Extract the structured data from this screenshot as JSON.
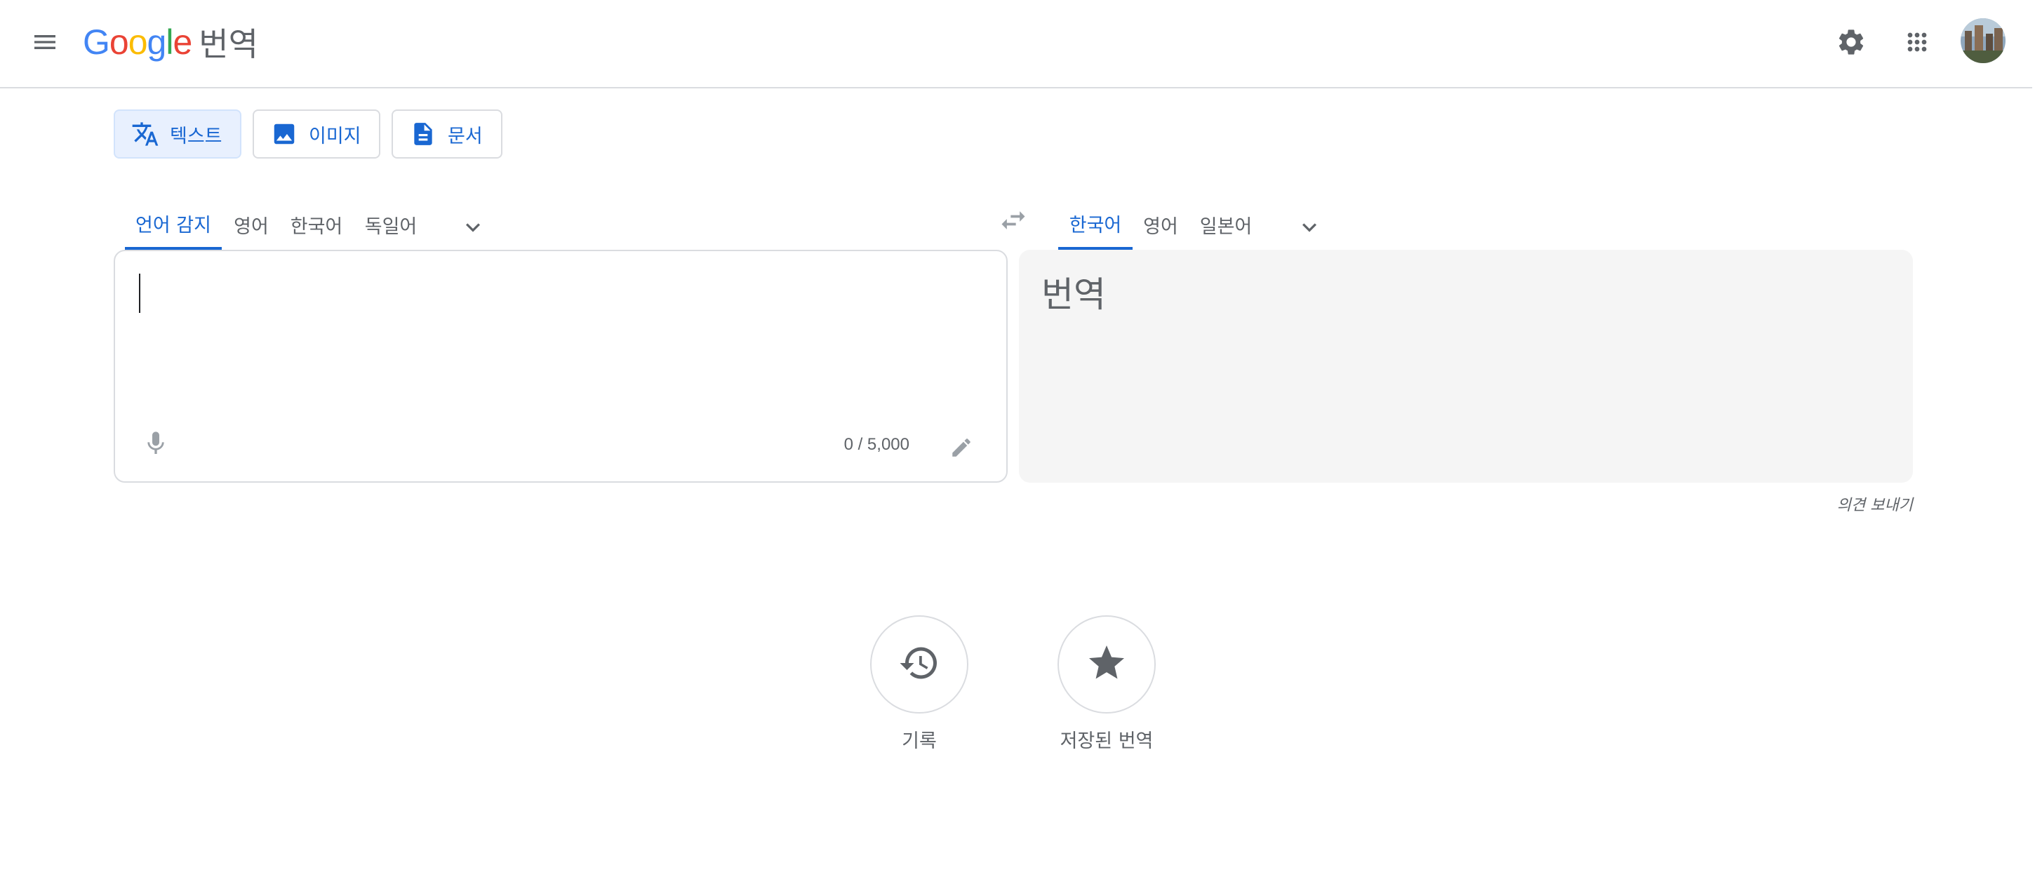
{
  "header": {
    "logo_word": "Google",
    "product_name": "번역",
    "icons": {
      "menu": "menu-icon",
      "settings": "gear-icon",
      "apps": "apps-grid-icon",
      "account": "account-avatar"
    }
  },
  "modes": [
    {
      "label": "텍스트",
      "icon": "translate-icon",
      "active": true
    },
    {
      "label": "이미지",
      "icon": "image-icon",
      "active": false
    },
    {
      "label": "문서",
      "icon": "document-icon",
      "active": false
    }
  ],
  "source": {
    "tabs": [
      {
        "label": "언어 감지",
        "active": true
      },
      {
        "label": "영어",
        "active": false
      },
      {
        "label": "한국어",
        "active": false
      },
      {
        "label": "독일어",
        "active": false
      }
    ],
    "input_value": "",
    "char_count": "0 / 5,000"
  },
  "target": {
    "tabs": [
      {
        "label": "한국어",
        "active": true
      },
      {
        "label": "영어",
        "active": false
      },
      {
        "label": "일본어",
        "active": false
      }
    ],
    "placeholder": "번역"
  },
  "feedback_link": "의견 보내기",
  "actions": [
    {
      "label": "기록",
      "icon": "history-icon"
    },
    {
      "label": "저장된 번역",
      "icon": "star-icon"
    }
  ],
  "colors": {
    "accent": "#1967d2",
    "active_tab_bg": "#e8f0fe",
    "border": "#dadce0",
    "icon_grey": "#5f6368",
    "target_bg": "#f5f5f5",
    "google_blue": "#4285f4",
    "google_red": "#ea4335",
    "google_yellow": "#fbbc05",
    "google_green": "#34a853"
  }
}
